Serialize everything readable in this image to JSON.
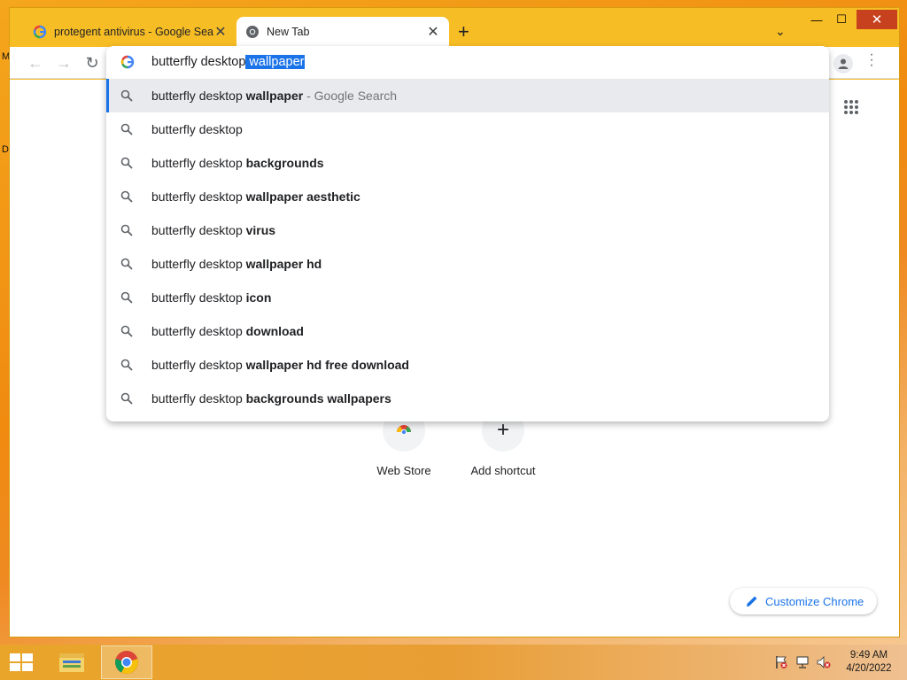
{
  "desktop": {
    "left_letters": [
      "M",
      "D"
    ]
  },
  "tabs": [
    {
      "title": "protegent antivirus - Google Search",
      "icon": "google-icon",
      "active": false
    },
    {
      "title": "New Tab",
      "icon": "chrome-icon",
      "active": true
    }
  ],
  "window_controls": {
    "minimize": "—",
    "maximize": "☐",
    "close": "✕"
  },
  "toolbar": {
    "back": "←",
    "forward": "→",
    "reload": "↻"
  },
  "omnibox": {
    "typed": "butterfly desktop",
    "autocomplete_selected": " wallpaper",
    "suggestions": [
      {
        "prefix": "butterfly desktop ",
        "bold": "wallpaper",
        "suffix": " - Google Search",
        "selected": true
      },
      {
        "prefix": "butterfly desktop",
        "bold": "",
        "suffix": "",
        "selected": false
      },
      {
        "prefix": "butterfly desktop ",
        "bold": "backgrounds",
        "suffix": "",
        "selected": false
      },
      {
        "prefix": "butterfly desktop ",
        "bold": "wallpaper aesthetic",
        "suffix": "",
        "selected": false
      },
      {
        "prefix": "butterfly desktop ",
        "bold": "virus",
        "suffix": "",
        "selected": false
      },
      {
        "prefix": "butterfly desktop ",
        "bold": "wallpaper hd",
        "suffix": "",
        "selected": false
      },
      {
        "prefix": "butterfly desktop ",
        "bold": "icon",
        "suffix": "",
        "selected": false
      },
      {
        "prefix": "butterfly desktop ",
        "bold": "download",
        "suffix": "",
        "selected": false
      },
      {
        "prefix": "butterfly desktop ",
        "bold": "wallpaper hd free download",
        "suffix": "",
        "selected": false
      },
      {
        "prefix": "butterfly desktop ",
        "bold": "backgrounds wallpapers",
        "suffix": "",
        "selected": false
      }
    ]
  },
  "shortcuts": [
    {
      "label": "Web Store",
      "icon": "chrome-web-store-icon"
    },
    {
      "label": "Add shortcut",
      "icon": "plus-icon",
      "glyph": "+"
    }
  ],
  "customize": {
    "label": "Customize Chrome",
    "icon": "pencil-icon"
  },
  "taskbar": {
    "apps": [
      "file-explorer-icon",
      "chrome-icon"
    ],
    "tray": [
      "action-center-flag-icon",
      "network-icon",
      "volume-muted-icon"
    ],
    "clock": {
      "time": "9:49 AM",
      "date": "4/20/2022"
    }
  },
  "colors": {
    "window_frame": "#f7bd25",
    "accent": "#1a73e8",
    "close_button": "#c7411f"
  }
}
